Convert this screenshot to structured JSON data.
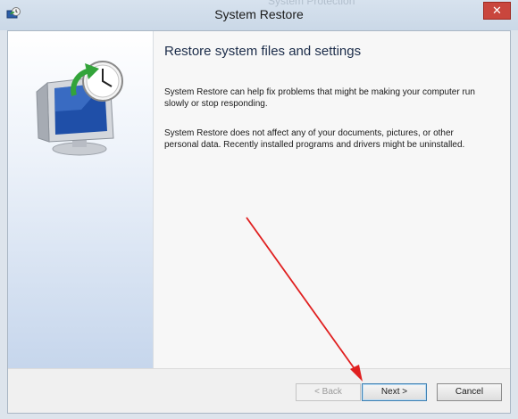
{
  "window": {
    "title": "System Restore",
    "ghost_title": "System Protection",
    "close_glyph": "✕"
  },
  "content": {
    "heading": "Restore system files and settings",
    "paragraph1": "System Restore can help fix problems that might be making your computer run slowly or stop responding.",
    "paragraph2": "System Restore does not affect any of your documents, pictures, or other personal data. Recently installed programs and drivers might be uninstalled."
  },
  "buttons": {
    "back": "< Back",
    "next": "Next >",
    "cancel": "Cancel"
  },
  "icons": {
    "app": "system-restore-icon",
    "illustration": "monitor-clock-restore-icon"
  },
  "annotation": {
    "arrow_color": "#e02020"
  },
  "colors": {
    "titlebar": "#cad8e7",
    "close": "#c9463d",
    "accent_border": "#3c7fb1"
  }
}
